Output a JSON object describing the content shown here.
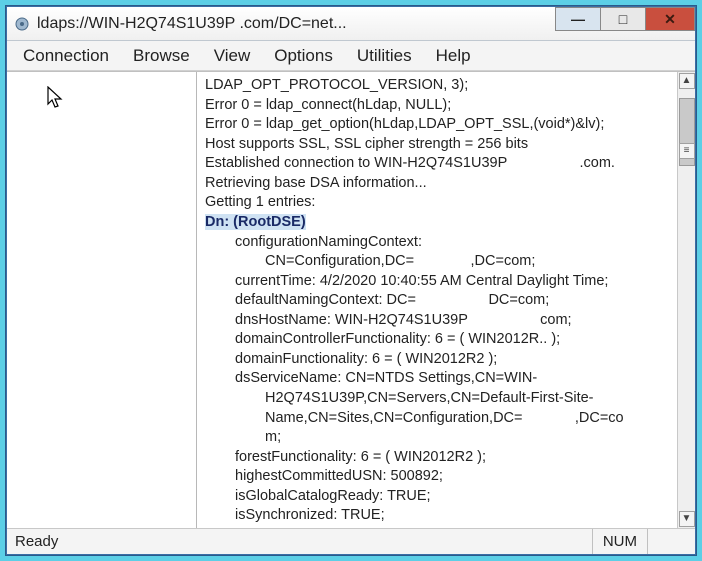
{
  "window": {
    "title": "ldaps://WIN-H2Q74S1U39P               .com/DC=net..."
  },
  "menu": {
    "items": [
      "Connection",
      "Browse",
      "View",
      "Options",
      "Utilities",
      "Help"
    ]
  },
  "log": {
    "lines": [
      "LDAP_OPT_PROTOCOL_VERSION, 3);",
      "Error 0 = ldap_connect(hLdap, NULL);",
      "Error 0 = ldap_get_option(hLdap,LDAP_OPT_SSL,(void*)&lv);",
      "Host supports SSL, SSL cipher strength = 256 bits",
      "Established connection to WIN-H2Q74S1U39P                  .com.",
      "Retrieving base DSA information...",
      "Getting 1 entries:"
    ],
    "dn_label": "Dn: (RootDSE)",
    "attrs": [
      {
        "k": "configurationNamingContext:",
        "v": "CN=Configuration,DC=              ,DC=com;",
        "wrap": true
      },
      {
        "k": "currentTime: 4/2/2020 10:40:55 AM Central Daylight Time;"
      },
      {
        "k": "defaultNamingContext: DC=                  DC=com;"
      },
      {
        "k": "dnsHostName: WIN-H2Q74S1U39P                  com;"
      },
      {
        "k": "domainControllerFunctionality: 6 = ( WIN2012R.. );"
      },
      {
        "k": "domainFunctionality: 6 = ( WIN2012R2 );"
      },
      {
        "k": "dsServiceName: CN=NTDS Settings,CN=WIN-",
        "v": "H2Q74S1U39P,CN=Servers,CN=Default-First-Site-",
        "v2": "Name,CN=Sites,CN=Configuration,DC=             ,DC=co",
        "v3": "m;"
      },
      {
        "k": "forestFunctionality: 6 = ( WIN2012R2 );"
      },
      {
        "k": "highestCommittedUSN: 500892;"
      },
      {
        "k": "isGlobalCatalogReady: TRUE;"
      },
      {
        "k": "isSynchronized: TRUE;"
      }
    ]
  },
  "status": {
    "left": "Ready",
    "num": "NUM"
  },
  "scroll": {
    "up": "▲",
    "down": "▼",
    "menu": "≡",
    "thumb_top_pct": 2,
    "thumb_h_pct": 16
  }
}
